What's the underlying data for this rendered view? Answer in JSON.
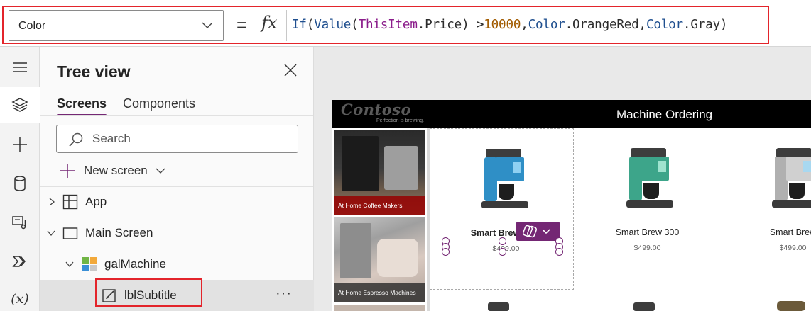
{
  "formula_bar": {
    "property": "Color",
    "equals": "=",
    "fx": "fx",
    "formula_tokens": [
      {
        "t": "If",
        "c": "fn"
      },
      {
        "t": "(",
        "c": "pl"
      },
      {
        "t": "Value",
        "c": "fn"
      },
      {
        "t": "(",
        "c": "pl"
      },
      {
        "t": "ThisItem",
        "c": "id"
      },
      {
        "t": ".Price",
        "c": "pl"
      },
      {
        "t": ") >",
        "c": "pl"
      },
      {
        "t": "10000",
        "c": "num"
      },
      {
        "t": ",",
        "c": "pl"
      },
      {
        "t": "Color",
        "c": "fn"
      },
      {
        "t": ".OrangeRed",
        "c": "pl"
      },
      {
        "t": ",",
        "c": "pl"
      },
      {
        "t": "Color",
        "c": "fn"
      },
      {
        "t": ".Gray",
        "c": "pl"
      },
      {
        "t": ")",
        "c": "pl"
      }
    ]
  },
  "rail": {
    "items": [
      "hamburger-menu-icon",
      "layers-icon",
      "insert-plus-icon",
      "data-cylinder-icon",
      "media-icon",
      "power-automate-icon",
      "variables-icon"
    ],
    "variables_label": "(x)"
  },
  "tree": {
    "title": "Tree view",
    "tabs": {
      "screens": "Screens",
      "components": "Components"
    },
    "search_placeholder": "Search",
    "new_screen": "New screen",
    "nodes": {
      "app": "App",
      "main_screen": "Main Screen",
      "gallery": "galMachine",
      "subtitle": "lblSubtitle",
      "more": "···"
    }
  },
  "app_preview": {
    "logo": "Contoso",
    "tagline": "Perfection is brewing.",
    "title": "Machine Ordering",
    "categories": [
      "At Home Coffee Makers",
      "At Home Espresso Machines"
    ],
    "products": [
      {
        "name": "Smart Brew",
        "price": "$499.00",
        "accent": "#2f8fc6"
      },
      {
        "name": "Smart Brew 300",
        "price": "$499.00",
        "accent": "#3da58a"
      },
      {
        "name": "Smart Brew",
        "price": "$499.00",
        "accent": "#b0b0b0"
      }
    ]
  },
  "colors": {
    "accent": "#742774",
    "highlight": "#e3242b"
  }
}
